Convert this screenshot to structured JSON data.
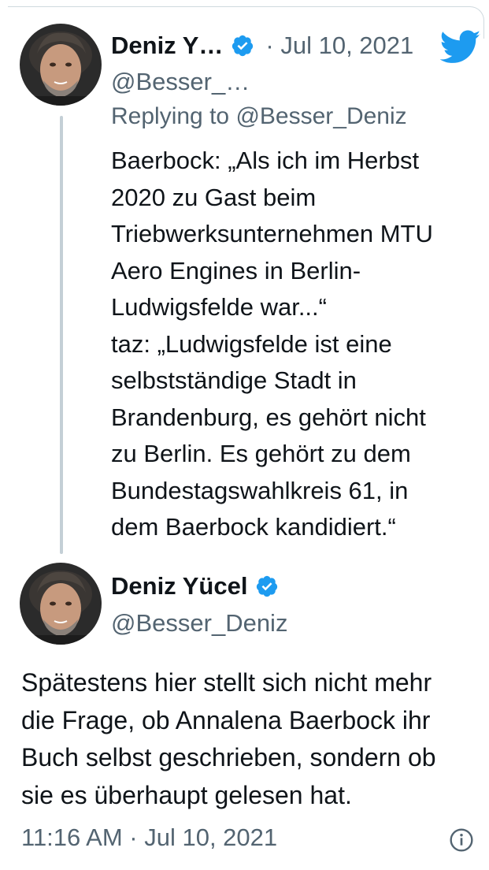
{
  "quoted_tweet": {
    "author_name": "Deniz Y…",
    "date": "· Jul 10, 2021",
    "handle": "@Besser_…",
    "replying_prefix": "Replying to",
    "replying_mention": "@Besser_Deniz",
    "lines": [
      "Baerbock: „Als ich im Herbst",
      "2020 zu Gast beim",
      "Triebwerksunternehmen MTU",
      "Aero Engines in Berlin-",
      "Ludwigsfelde war...“",
      "taz: „Ludwigsfelde ist eine",
      "selbstständige Stadt in",
      "Brandenburg, es gehört nicht",
      "zu Berlin. Es gehört zu dem",
      "Bundestagswahlkreis 61, in",
      "dem Baerbock kandidiert.“"
    ]
  },
  "main_tweet": {
    "author_name": "Deniz Yücel",
    "handle": "@Besser_Deniz",
    "lines": [
      "Spätestens hier stellt sich nicht mehr",
      "die Frage, ob Annalena Baerbock ihr",
      "Buch selbst geschrieben, sondern ob",
      "sie es überhaupt gelesen hat."
    ],
    "timestamp": "11:16 AM · Jul 10, 2021"
  },
  "icons": {
    "verified": "verified-badge-icon",
    "twitter": "twitter-bird-icon",
    "info": "info-icon"
  },
  "colors": {
    "accent": "#1d9bf0",
    "secondary_text": "#536471",
    "thread_line": "#c4cfd6"
  }
}
